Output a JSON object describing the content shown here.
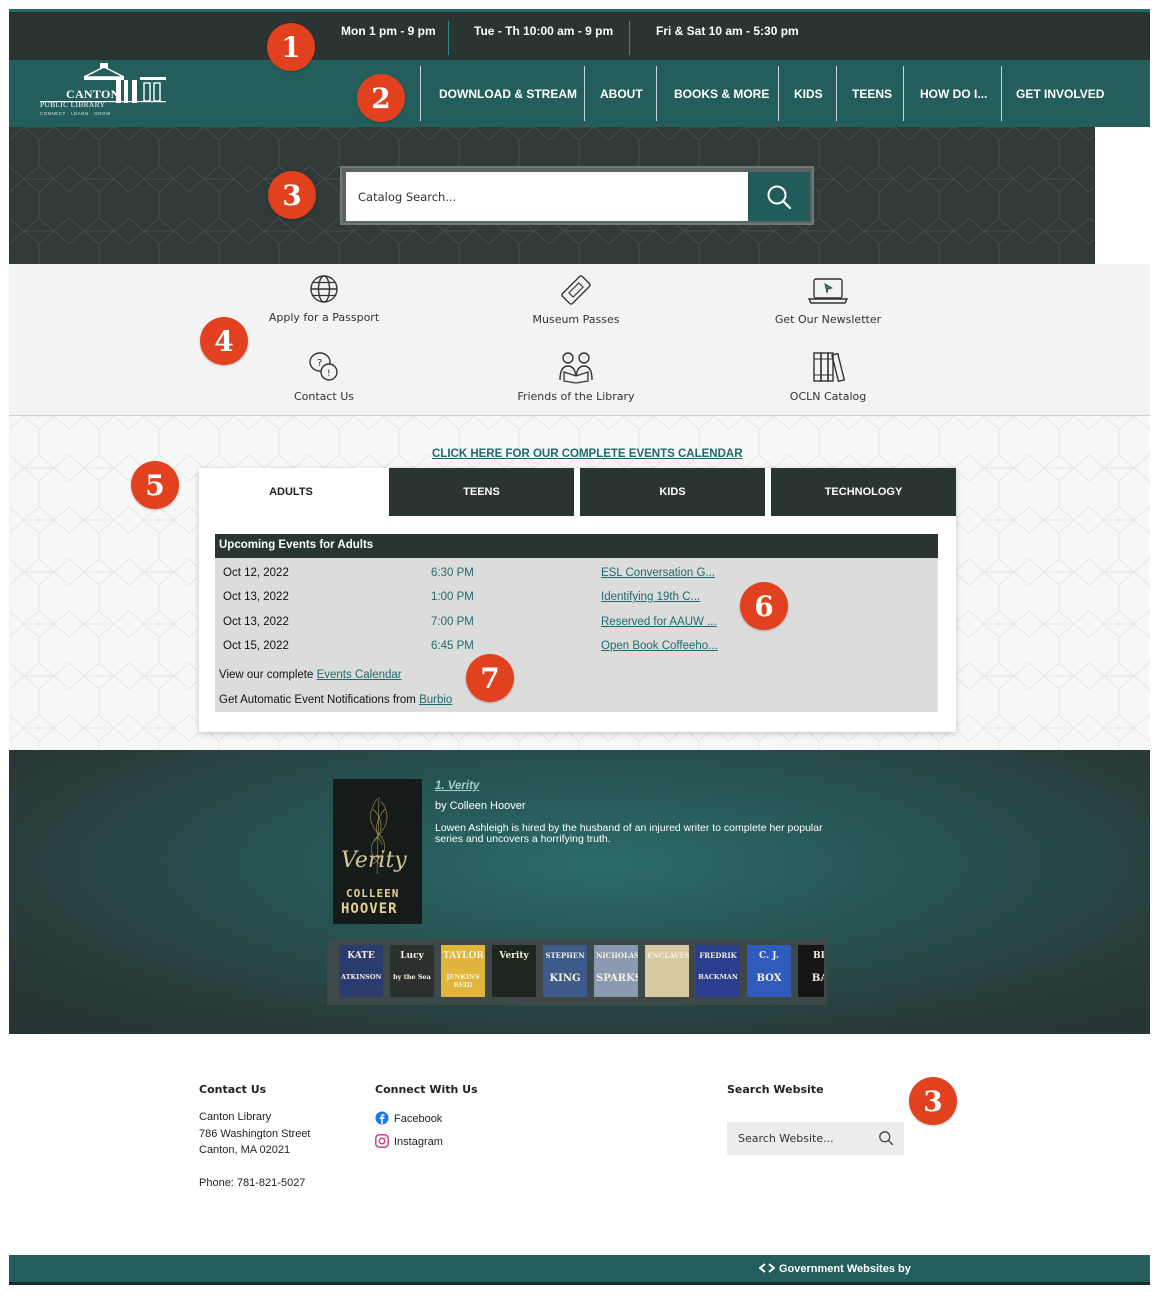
{
  "hours": [
    "Mon 1 pm - 9 pm",
    "Tue - Th 10:00 am - 9 pm",
    "Fri & Sat 10 am - 5:30 pm"
  ],
  "logo": {
    "line1": "CANTON",
    "line2": "PUBLIC LIBRARY",
    "line3": "CONNECT · LEARN · GROW"
  },
  "nav": [
    "DOWNLOAD & STREAM",
    "ABOUT",
    "BOOKS & MORE",
    "KIDS",
    "TEENS",
    "HOW DO I...",
    "GET INVOLVED"
  ],
  "catalog_search": {
    "placeholder": "Catalog Search..."
  },
  "quick_links": [
    {
      "label": "Apply for a Passport",
      "icon": "globe-icon"
    },
    {
      "label": "Museum Passes",
      "icon": "ticket-icon"
    },
    {
      "label": "Get Our Newsletter",
      "icon": "laptop-icon"
    },
    {
      "label": "Contact Us",
      "icon": "chat-question-icon"
    },
    {
      "label": "Friends of the Library",
      "icon": "readers-icon"
    },
    {
      "label": "OCLN Catalog",
      "icon": "books-icon"
    }
  ],
  "events": {
    "calendar_link": "CLICK HERE FOR OUR COMPLETE EVENTS CALENDAR",
    "tabs": [
      "ADULTS",
      "TEENS",
      "KIDS",
      "TECHNOLOGY"
    ],
    "active_tab": "ADULTS",
    "heading": "Upcoming Events for Adults",
    "rows": [
      {
        "date": "Oct 12, 2022",
        "time": "6:30 PM",
        "title": "ESL Conversation G..."
      },
      {
        "date": "Oct 13, 2022",
        "time": "1:00 PM",
        "title": "Identifying 19th C..."
      },
      {
        "date": "Oct 13, 2022",
        "time": "7:00 PM",
        "title": "Reserved for AAUW ..."
      },
      {
        "date": "Oct 15, 2022",
        "time": "6:45 PM",
        "title": "Open Book Coffeeho..."
      }
    ],
    "footer1_text": "View our complete ",
    "footer1_link": "Events Calendar",
    "footer2_text": "Get Automatic Event Notifications from ",
    "footer2_link": "Burbio"
  },
  "featured_book": {
    "title": "1. Verity",
    "author": "by Colleen Hoover",
    "description": "Lowen Ashleigh is hired by the husband of an injured writer to complete her popular series and uncovers a horrifying truth.",
    "cover_title": "Verity",
    "cover_author_1": "COLLEEN",
    "cover_author_2": "HOOVER"
  },
  "carousel": [
    {
      "line1": "KATE",
      "line2": "ATKINSON",
      "color": "#2b3b6e"
    },
    {
      "line1": "Lucy",
      "line2": "by the Sea",
      "color": "#2b2f2d"
    },
    {
      "line1": "TAYLOR",
      "line2": "JENKINS REID",
      "color": "#e0b53b"
    },
    {
      "line1": "Verity",
      "line2": "",
      "color": "#1e2620"
    },
    {
      "line1": "STEPHEN",
      "line2": "KING",
      "color": "#3d5a8a"
    },
    {
      "line1": "NICHOLAS",
      "line2": "SPARKS",
      "color": "#8a9ab0"
    },
    {
      "line1": "ENCLAVES",
      "line2": "",
      "color": "#d9c9a3"
    },
    {
      "line1": "FREDRIK",
      "line2": "BACKMAN",
      "color": "#2a3d8f"
    },
    {
      "line1": "C. J.",
      "line2": "BOX",
      "color": "#2f5bbd"
    },
    {
      "line1": "BL",
      "line2": "BA",
      "color": "#161616"
    }
  ],
  "footer": {
    "contact_head": "Contact Us",
    "library": "Canton Library",
    "street": "786 Washington Street",
    "city": "Canton, MA 02021",
    "phone": "Phone: 781-821-5027",
    "connect_head": "Connect With Us",
    "facebook": "Facebook",
    "instagram": "Instagram",
    "search_head": "Search Website",
    "search_placeholder": "Search Website..."
  },
  "gov_credit": "Government Websites by",
  "markers": [
    "1",
    "2",
    "3",
    "4",
    "5",
    "6",
    "7",
    "3"
  ],
  "colors": {
    "teal": "#235e5d",
    "dark": "#2a3433",
    "marker": "#e2411f",
    "link": "#1f6a6a"
  }
}
